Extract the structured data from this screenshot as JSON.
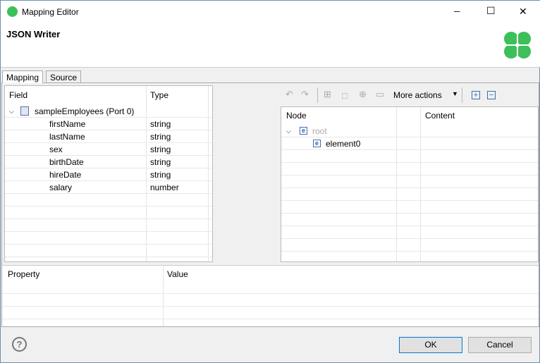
{
  "window": {
    "title": "Mapping Editor",
    "minimize": "─",
    "maximize": "☐",
    "close": "✕"
  },
  "header": {
    "title": "JSON Writer"
  },
  "tabs": [
    {
      "label": "Mapping",
      "active": true
    },
    {
      "label": "Source",
      "active": false
    }
  ],
  "fields": {
    "col_field": "Field",
    "col_type": "Type",
    "port": "sampleEmployees (Port 0)",
    "rows": [
      {
        "name": "firstName",
        "type": "string"
      },
      {
        "name": "lastName",
        "type": "string"
      },
      {
        "name": "sex",
        "type": "string"
      },
      {
        "name": "birthDate",
        "type": "string"
      },
      {
        "name": "hireDate",
        "type": "string"
      },
      {
        "name": "salary",
        "type": "number"
      }
    ]
  },
  "toolbar": {
    "more_actions": "More actions"
  },
  "tree": {
    "col_node": "Node",
    "col_content": "Content",
    "root": "root",
    "child": "element0",
    "element_glyph": "e"
  },
  "properties": {
    "col_property": "Property",
    "col_value": "Value"
  },
  "footer": {
    "help": "?",
    "ok": "OK",
    "cancel": "Cancel"
  },
  "colors": {
    "accent": "#0078d7",
    "logo": "#3dbf5a"
  }
}
